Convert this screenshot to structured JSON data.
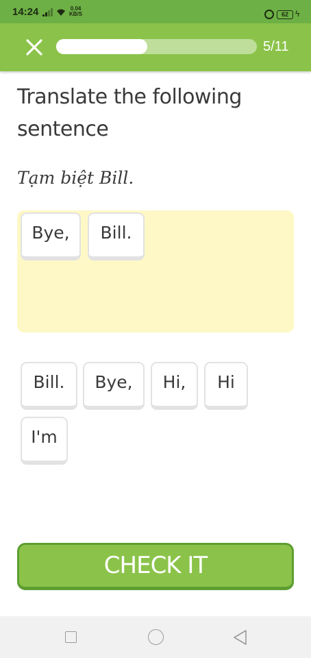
{
  "status_bar": {
    "time": "14:24",
    "net_speed_value": "0.04",
    "net_speed_unit": "KB/S",
    "battery": "62"
  },
  "header": {
    "progress_text": "5/11",
    "progress_fraction": 0.4545
  },
  "exercise": {
    "prompt": "Translate the following sentence",
    "source_sentence": "Tạm biệt Bill."
  },
  "answer_chips": [
    "Bye,",
    "Bill."
  ],
  "word_bank": [
    "Bill.",
    "Bye,",
    "Hi,",
    "Hi",
    "I'm"
  ],
  "check_button": "CHECK IT",
  "colors": {
    "header_green": "#8bc34a",
    "status_green": "#6db046",
    "answer_area": "#fef8c6",
    "button_border": "#5e9e32"
  },
  "icons": {
    "close": "close-icon",
    "nav_recent": "square-icon",
    "nav_home": "circle-icon",
    "nav_back": "triangle-back-icon"
  }
}
